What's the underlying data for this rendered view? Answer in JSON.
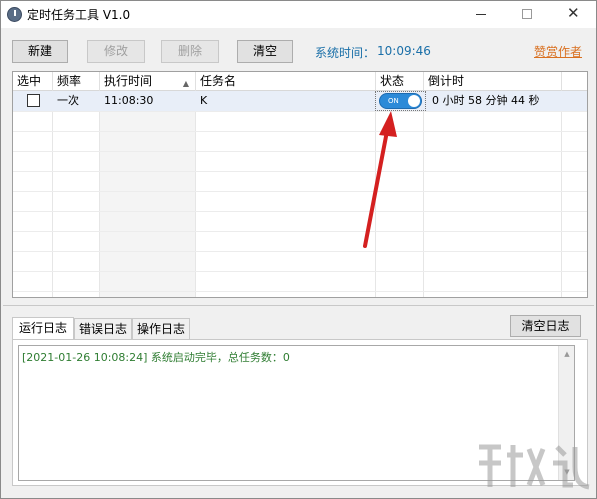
{
  "window": {
    "title": "定时任务工具 V1.0"
  },
  "toolbar": {
    "new_label": "新建",
    "edit_label": "修改",
    "delete_label": "删除",
    "clear_label": "清空",
    "systime_label": "系统时间：",
    "systime_value": "10:09:46",
    "donate_label": "赞赏作者"
  },
  "task_grid": {
    "columns": [
      "选中",
      "频率",
      "执行时间",
      "任务名",
      "状态",
      "倒计时"
    ],
    "rows": [
      {
        "checked": false,
        "frequency": "一次",
        "exec_time": "11:08:30",
        "task_name": "K",
        "status": "ON",
        "countdown": "0 小时 58 分钟 44 秒"
      }
    ]
  },
  "log": {
    "tabs": [
      "运行日志",
      "错误日志",
      "操作日志"
    ],
    "active_tab": 0,
    "clear_log_label": "清空日志",
    "lines": [
      "[2021-01-26 10:08:24] 系统启动完毕，总任务数：0"
    ]
  },
  "colors": {
    "accent_blue": "#1a6fa8",
    "toggle_on": "#2c8ad8",
    "donate_orange": "#d97020",
    "log_green": "#2f7d32",
    "annotation_red": "#d42020"
  }
}
